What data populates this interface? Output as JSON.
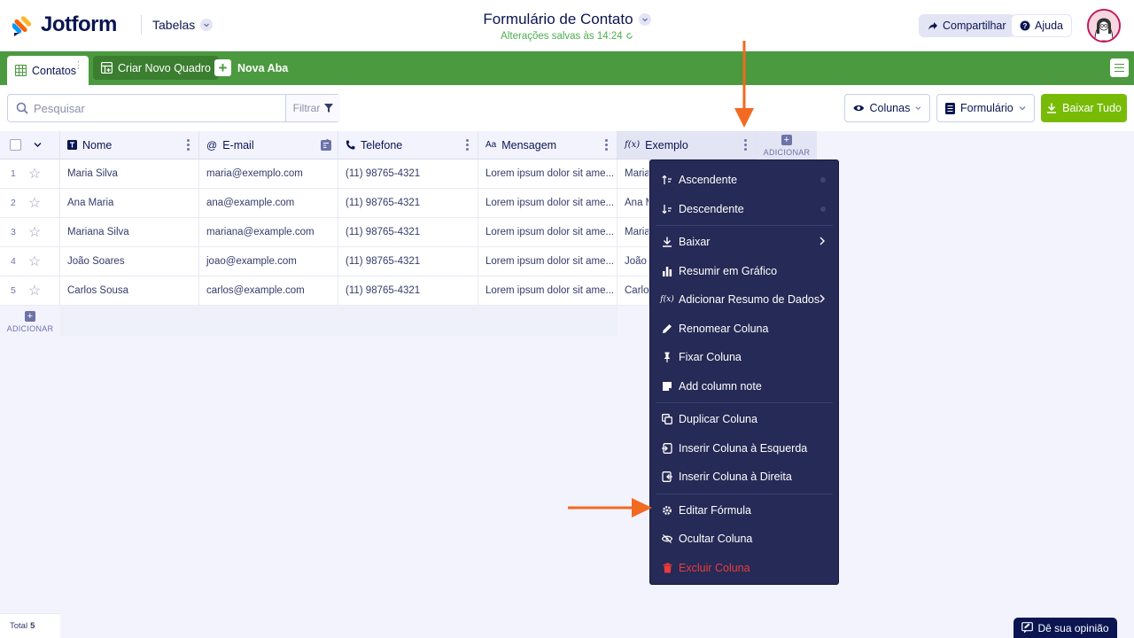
{
  "header": {
    "logo_text": "Jotform",
    "tables_label": "Tabelas",
    "form_title": "Formulário de Contato",
    "saved_status": "Alterações salvas às 14:24",
    "share_label": "Compartilhar",
    "help_label": "Ajuda"
  },
  "tabs": {
    "active_label": "Contatos",
    "new_board_label": "Criar Novo Quadro",
    "new_tab_label": "Nova Aba"
  },
  "toolbar": {
    "search_placeholder": "Pesquisar",
    "filter_label": "Filtrar",
    "columns_label": "Colunas",
    "form_label": "Formulário",
    "download_all_label": "Baixar Tudo"
  },
  "table": {
    "columns": [
      "Nome",
      "E-mail",
      "Telefone",
      "Mensagem",
      "Exemplo"
    ],
    "add_column_label": "ADICIONAR",
    "add_row_label": "ADICIONAR",
    "rows": [
      {
        "num": "1",
        "nome": "Maria Silva",
        "email": "maria@exemplo.com",
        "telefone": "(11) 98765-4321",
        "mensagem": "Lorem ipsum dolor sit ame...",
        "exemplo": "Maria"
      },
      {
        "num": "2",
        "nome": "Ana Maria",
        "email": "ana@example.com",
        "telefone": "(11) 98765-4321",
        "mensagem": "Lorem ipsum dolor sit ame...",
        "exemplo": "Ana M"
      },
      {
        "num": "3",
        "nome": "Mariana Silva",
        "email": "mariana@example.com",
        "telefone": "(11) 98765-4321",
        "mensagem": "Lorem ipsum dolor sit ame...",
        "exemplo": "Maria"
      },
      {
        "num": "4",
        "nome": "João Soares",
        "email": "joao@example.com",
        "telefone": "(11) 98765-4321",
        "mensagem": "Lorem ipsum dolor sit ame...",
        "exemplo": "João"
      },
      {
        "num": "5",
        "nome": "Carlos Sousa",
        "email": "carlos@example.com",
        "telefone": "(11) 98765-4321",
        "mensagem": "Lorem ipsum dolor sit ame...",
        "exemplo": "Carlo"
      }
    ]
  },
  "context_menu": {
    "ascending": "Ascendente",
    "descending": "Descendente",
    "download": "Baixar",
    "summarize_chart": "Resumir em Gráfico",
    "add_data_summary": "Adicionar Resumo de Dados",
    "rename_column": "Renomear Coluna",
    "pin_column": "Fixar Coluna",
    "add_column_note": "Add column note",
    "duplicate_column": "Duplicar Coluna",
    "insert_left": "Inserir Coluna à Esquerda",
    "insert_right": "Inserir Coluna à Direita",
    "edit_formula": "Editar Fórmula",
    "hide_column": "Ocultar Coluna",
    "delete_column": "Excluir Coluna"
  },
  "footer": {
    "total_label": "Total",
    "total_count": "5",
    "feedback_label": "Dê sua opinião"
  },
  "colors": {
    "brand_green": "#4c9a3f",
    "download_green": "#78bb07",
    "menu_bg": "#252a56",
    "annotation_orange": "#f26a21",
    "danger_red": "#ec3b3b"
  }
}
